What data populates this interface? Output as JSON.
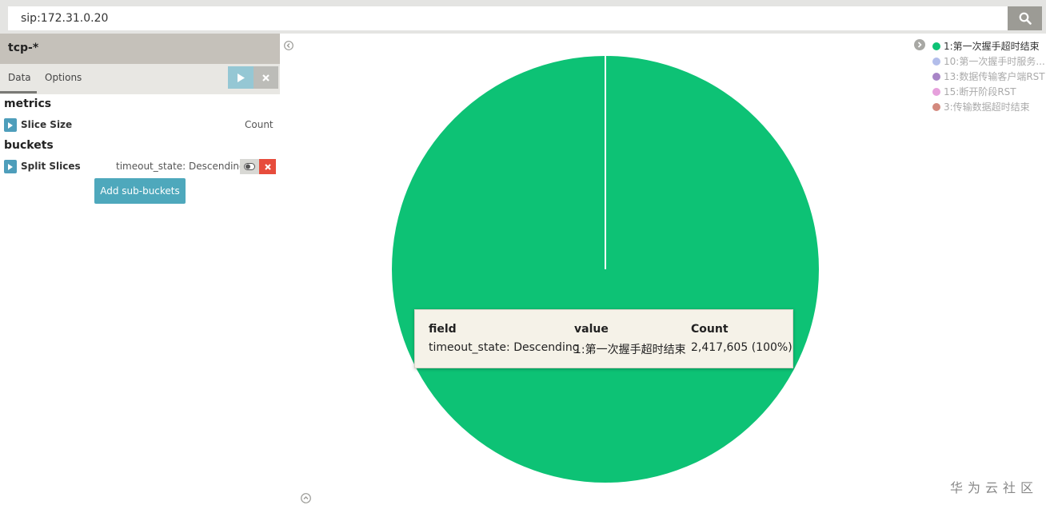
{
  "search": {
    "query": "sip:172.31.0.20"
  },
  "panel": {
    "index_pattern": "tcp-*",
    "tabs": [
      "Data",
      "Options"
    ],
    "metrics_title": "metrics",
    "buckets_title": "buckets",
    "metric": {
      "label": "Slice Size",
      "summary": "Count"
    },
    "bucket": {
      "label": "Split Slices",
      "summary": "timeout_state: Descending"
    },
    "add_sub_buckets_label": "Add sub-buckets"
  },
  "legend": {
    "items": [
      {
        "label": "1:第一次握手超时结束",
        "color": "#0dc275",
        "active": true
      },
      {
        "label": "10:第一次握手时服务...",
        "color": "#b2bdea",
        "active": false
      },
      {
        "label": "13:数据传输客户端RST",
        "color": "#a885c7",
        "active": false
      },
      {
        "label": "15:断开阶段RST",
        "color": "#e6a0dc",
        "active": false
      },
      {
        "label": "3:传输数据超时结束",
        "color": "#d3897e",
        "active": false
      }
    ]
  },
  "tooltip": {
    "headers": {
      "field": "field",
      "value": "value",
      "count": "Count"
    },
    "row": {
      "field": "timeout_state: Descending",
      "value": "1:第一次握手超时结束",
      "count": "2,417,605 (100%)"
    }
  },
  "chart_data": {
    "type": "pie",
    "categories": [
      "1:第一次握手超时结束"
    ],
    "values": [
      2417605
    ],
    "colors": [
      "#0dc275"
    ]
  },
  "watermark": "华为云社区",
  "colors": {
    "pie_main": "#0dc275",
    "accent": "#4e9ebb",
    "danger": "#e74c3c"
  }
}
